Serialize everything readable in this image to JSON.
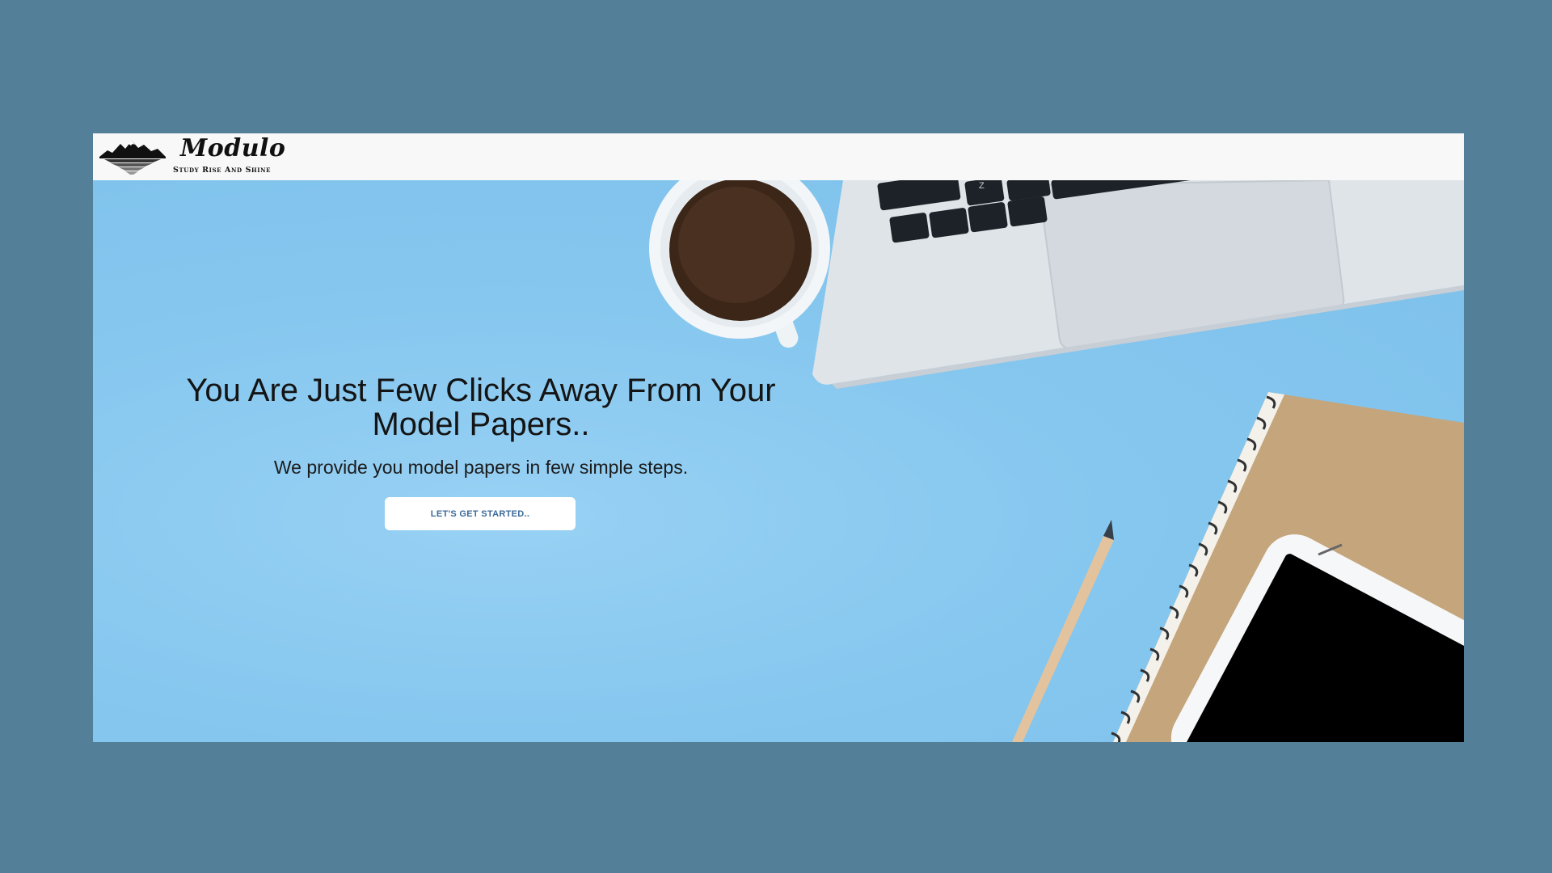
{
  "brand": {
    "name": "Modulo",
    "tagline": "Study Rise And Shine",
    "logo_icon": "mountain-logo-icon"
  },
  "hero": {
    "title": "You Are Just Few Clicks Away From Your Model Papers..",
    "subtitle": "We provide you model papers in few simple steps.",
    "cta_label": "LET'S GET STARTED..",
    "keyboard_key_label": "Z"
  },
  "colors": {
    "page_background": "#547f98",
    "hero_background": "#86c6ee",
    "navbar_background": "#f8f8f8",
    "cta_text": "#3b6a9a"
  }
}
